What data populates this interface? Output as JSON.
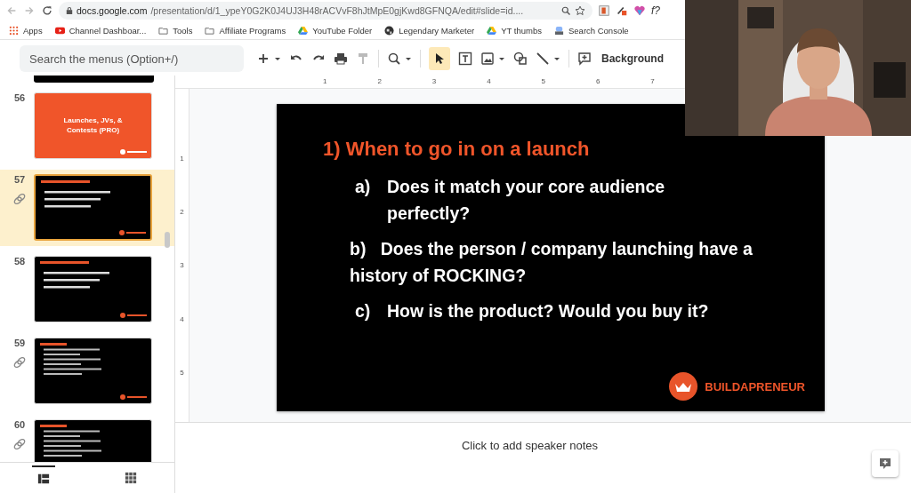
{
  "browser": {
    "url_host": "docs.google.com",
    "url_path": "/presentation/d/1_ypeY0G2K0J4UJ3H48rACVvF8hJtMpE0gjKwd8GFNQA/edit#slide=id....",
    "extension_text": "f?",
    "bookmarks": [
      {
        "label": "Apps",
        "kind": "apps"
      },
      {
        "label": "Channel Dashboar...",
        "kind": "video"
      },
      {
        "label": "Tools",
        "kind": "folder"
      },
      {
        "label": "Affiliate Programs",
        "kind": "folder"
      },
      {
        "label": "YouTube Folder",
        "kind": "drive"
      },
      {
        "label": "Legendary Marketer",
        "kind": "globe"
      },
      {
        "label": "YT thumbs",
        "kind": "drive"
      },
      {
        "label": "Search Console",
        "kind": "console"
      }
    ]
  },
  "toolbar": {
    "search_placeholder": "Search the menus (Option+/)",
    "background_button": "Background"
  },
  "ruler": {
    "horizontal": [
      "1",
      "2",
      "3",
      "4",
      "5",
      "6",
      "7"
    ],
    "vertical": [
      "1",
      "2",
      "3",
      "4",
      "5"
    ]
  },
  "slides": [
    {
      "number": "56",
      "kind": "section",
      "selected": false,
      "linked": false,
      "title": "Launches, JVs, & Contests (PRO)"
    },
    {
      "number": "57",
      "kind": "content",
      "selected": true,
      "linked": true
    },
    {
      "number": "58",
      "kind": "content",
      "selected": false,
      "linked": false
    },
    {
      "number": "59",
      "kind": "list",
      "selected": false,
      "linked": true
    },
    {
      "number": "60",
      "kind": "list",
      "selected": false,
      "linked": true
    }
  ],
  "slide": {
    "title": "1) When to go in on a launch",
    "items": [
      {
        "label": "a)",
        "text": "Does it match your core audience perfectly?",
        "kind": "hanging"
      },
      {
        "label": "b)",
        "text": "Does the person / company launching have a history of ROCKING?",
        "kind": "inline"
      },
      {
        "label": "c)",
        "text": "How is the product? Would you buy it?",
        "kind": "hanging"
      }
    ],
    "logo": "BUILDAPRENEUR"
  },
  "notes": {
    "placeholder": "Click to add speaker notes"
  }
}
